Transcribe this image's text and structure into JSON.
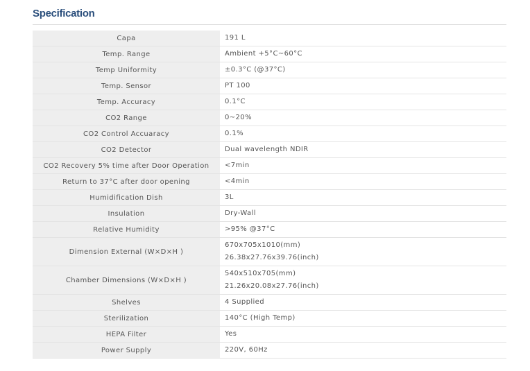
{
  "title": "Specification",
  "rows": [
    {
      "label": "Capa",
      "value": [
        "191 L"
      ]
    },
    {
      "label": "Temp. Range",
      "value": [
        "Ambient +5°C~60°C"
      ]
    },
    {
      "label": "Temp Uniformity",
      "value": [
        "±0.3°C (@37°C)"
      ]
    },
    {
      "label": "Temp. Sensor",
      "value": [
        "PT 100"
      ]
    },
    {
      "label": "Temp. Accuracy",
      "value": [
        "0.1°C"
      ]
    },
    {
      "label": "CO2 Range",
      "value": [
        "0~20%"
      ]
    },
    {
      "label": "CO2 Control Accuaracy",
      "value": [
        "0.1%"
      ]
    },
    {
      "label": "CO2 Detector",
      "value": [
        "Dual wavelength NDIR"
      ]
    },
    {
      "label": "CO2 Recovery 5% time after Door Operation",
      "value": [
        "<7min"
      ]
    },
    {
      "label": "Return to 37°C after door opening",
      "value": [
        "<4min"
      ]
    },
    {
      "label": "Humidification Dish",
      "value": [
        "3L"
      ]
    },
    {
      "label": "Insulation",
      "value": [
        "Dry-Wall"
      ]
    },
    {
      "label": "Relative Humidity",
      "value": [
        ">95% @37°C"
      ]
    },
    {
      "label": "Dimension External (W×D×H )",
      "value": [
        "670x705x1010(mm)",
        "26.38x27.76x39.76(inch)"
      ]
    },
    {
      "label": "Chamber Dimensions (W×D×H )",
      "value": [
        "540x510x705(mm)",
        "21.26x20.08x27.76(inch)"
      ]
    },
    {
      "label": "Shelves",
      "value": [
        "4 Supplied"
      ]
    },
    {
      "label": "Sterilization",
      "value": [
        "140°C (High Temp)"
      ]
    },
    {
      "label": "HEPA Filter",
      "value": [
        "Yes"
      ]
    },
    {
      "label": "Power Supply",
      "value": [
        "220V, 60Hz"
      ]
    }
  ]
}
